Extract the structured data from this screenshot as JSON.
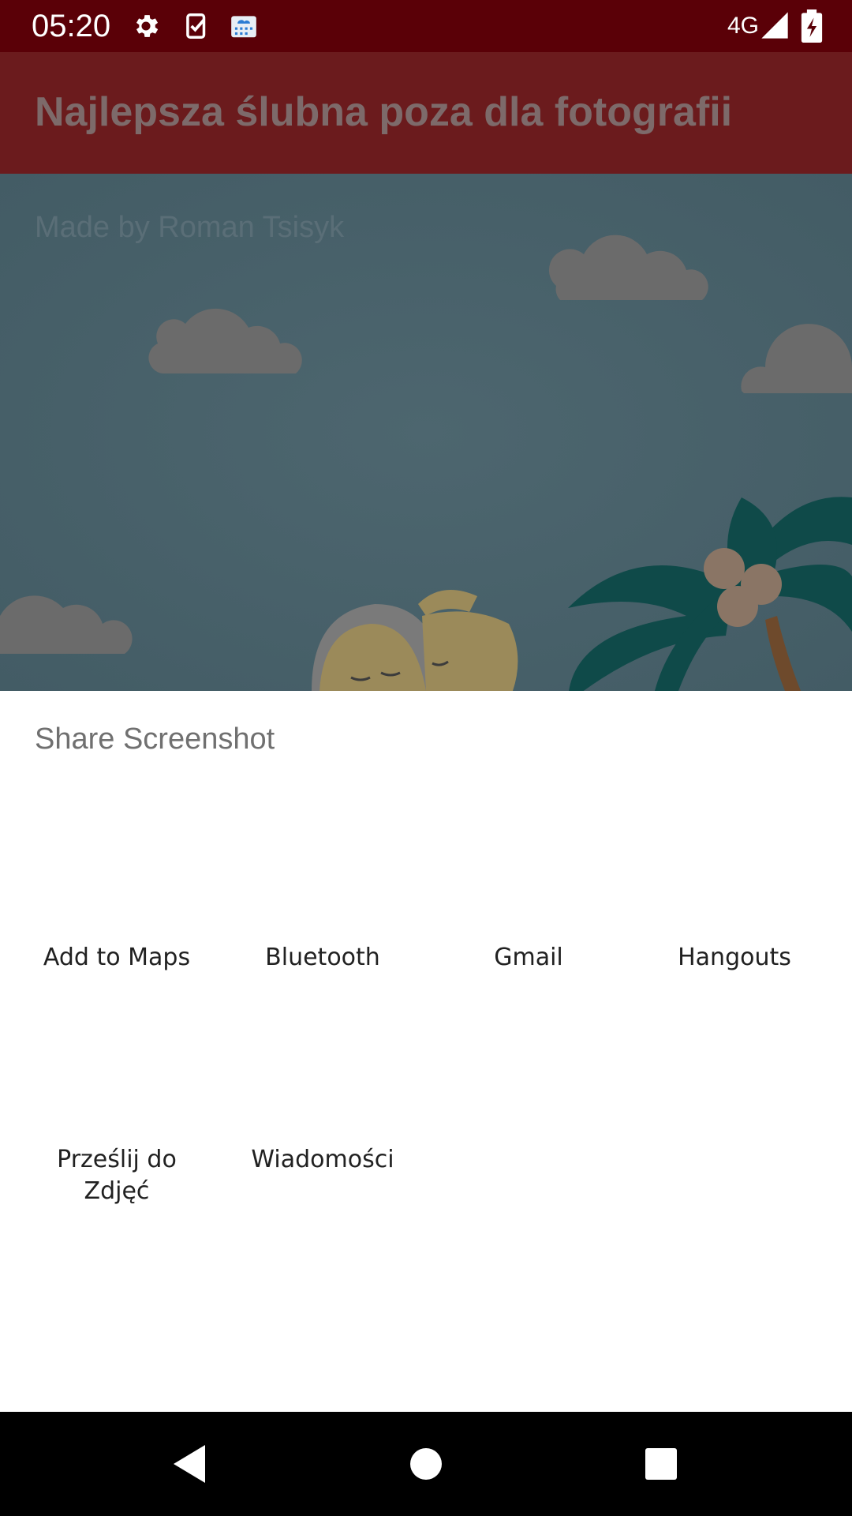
{
  "status_bar": {
    "time": "05:20",
    "network": "4G",
    "icons": [
      "settings-icon",
      "task-check-icon",
      "cloud-calendar-icon",
      "signal-icon",
      "battery-charging-icon"
    ]
  },
  "app": {
    "title": "Najlepsza ślubna poza dla fotografii",
    "made_by": "Made by Roman Tsisyk",
    "colors": {
      "app_bar": "#6b1b1d",
      "status_bar": "#5a0007",
      "background": "#46606a"
    }
  },
  "share_sheet": {
    "title": "Share Screenshot",
    "targets": [
      {
        "label": "Add to Maps"
      },
      {
        "label": "Bluetooth"
      },
      {
        "label": "Gmail"
      },
      {
        "label": "Hangouts"
      },
      {
        "label": "Prześlij do Zdjęć"
      },
      {
        "label": "Wiadomości"
      }
    ]
  },
  "nav_bar": {
    "buttons": [
      "back-icon",
      "home-icon",
      "recents-icon"
    ]
  }
}
